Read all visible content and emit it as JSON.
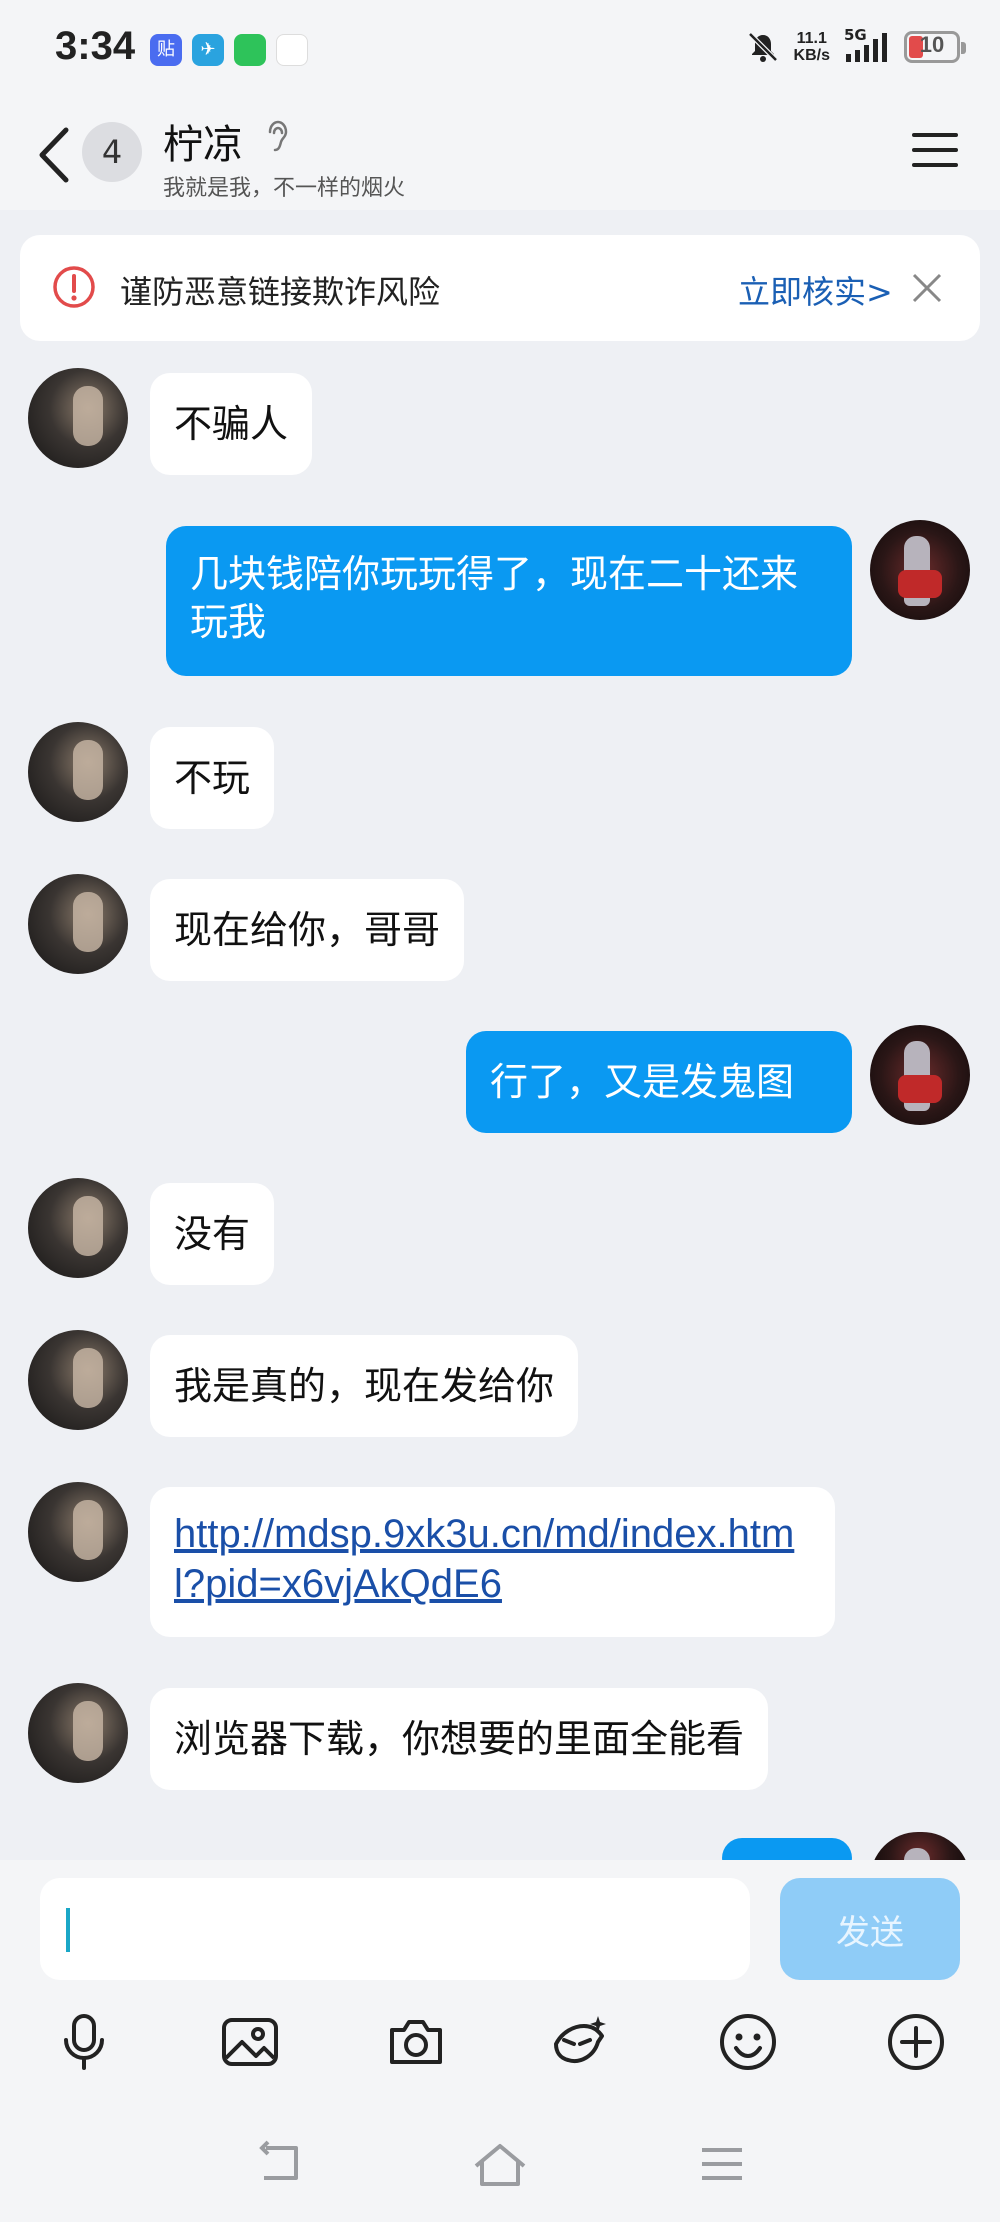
{
  "status_bar": {
    "time": "3:34",
    "app_icons": [
      "贴",
      "✈",
      "WeChat",
      "QQ"
    ],
    "net_speed_value": "11.1",
    "net_speed_unit": "KB/s",
    "network": "5G",
    "battery": "10"
  },
  "header": {
    "unread_count": "4",
    "contact_name": "柠凉",
    "subtitle": "我就是我，不一样的烟火"
  },
  "warning": {
    "text": "谨防恶意链接欺诈风险",
    "link": "立即核实>"
  },
  "messages": [
    {
      "side": "in",
      "text": "不骗人"
    },
    {
      "side": "out",
      "text": "几块钱陪你玩玩得了，现在二十还来玩我"
    },
    {
      "side": "in",
      "text": "不玩"
    },
    {
      "side": "in",
      "text": "现在给你，哥哥"
    },
    {
      "side": "out",
      "text": "行了，又是发鬼图"
    },
    {
      "side": "in",
      "text": "没有"
    },
    {
      "side": "in",
      "text": "我是真的，现在发给你"
    },
    {
      "side": "in",
      "text": "http://mdsp.9xk3u.cn/md/index.html?pid=x6vjAkQdE6"
    },
    {
      "side": "in",
      "text": "浏览器下载，你想要的里面全能看"
    }
  ],
  "input": {
    "value": "",
    "send_label": "发送"
  },
  "toolbar": [
    "microphone-icon",
    "image-icon",
    "camera-icon",
    "sticker-icon",
    "emoji-icon",
    "plus-icon"
  ],
  "nav": [
    "back-nav-icon",
    "home-nav-icon",
    "recents-nav-icon"
  ],
  "colors": {
    "outgoing_bubble": "#0a99f2",
    "incoming_bubble": "#ffffff",
    "background": "#eef0f4",
    "link": "#1a4fa8",
    "warning_icon": "#e24b4b"
  }
}
